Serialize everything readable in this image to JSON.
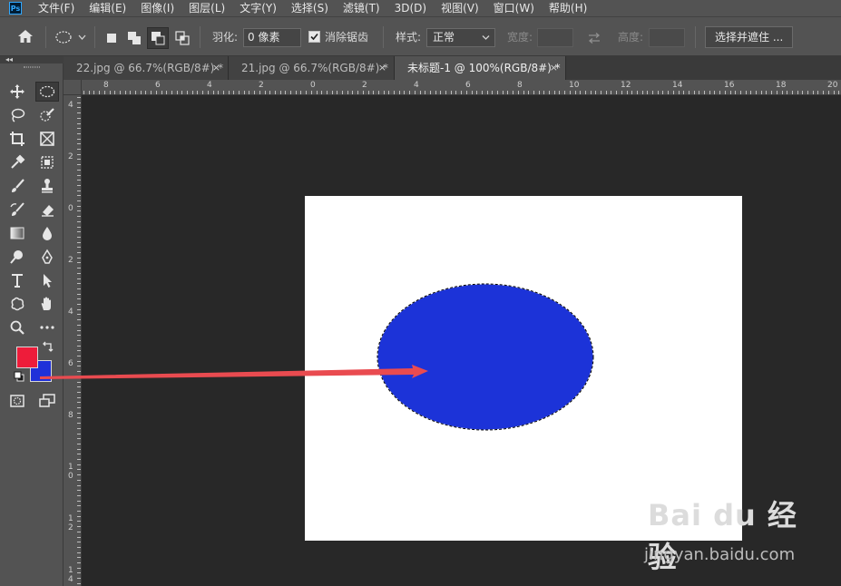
{
  "app": {
    "logo_text": "Ps"
  },
  "menu": [
    "文件(F)",
    "编辑(E)",
    "图像(I)",
    "图层(L)",
    "文字(Y)",
    "选择(S)",
    "滤镜(T)",
    "3D(D)",
    "视图(V)",
    "窗口(W)",
    "帮助(H)"
  ],
  "options": {
    "feather_label": "羽化:",
    "feather_value": "0 像素",
    "antialias_label": "消除锯齿",
    "antialias_checked": true,
    "style_label": "样式:",
    "style_value": "正常",
    "width_label": "宽度:",
    "height_label": "高度:",
    "select_mask_button": "选择并遮住 ..."
  },
  "tabs": [
    {
      "label": "22.jpg @ 66.7%(RGB/8#) *",
      "close": "×",
      "active": false
    },
    {
      "label": "21.jpg @ 66.7%(RGB/8#) *",
      "close": "×",
      "active": false
    },
    {
      "label": "未标题-1 @ 100%(RGB/8#) *",
      "close": "×",
      "active": true
    }
  ],
  "toolbar": {
    "collapse_glyph": "◂◂"
  },
  "colors": {
    "foreground": "#ee1c3a",
    "background": "#1f31d9",
    "ellipse_fill": "#1c33d8",
    "arrow": "#e94b50",
    "document": "#ffffff"
  },
  "ruler": {
    "top_labels": [
      "8",
      "6",
      "4",
      "2",
      "0",
      "2",
      "4",
      "6",
      "8",
      "10",
      "12",
      "14",
      "16",
      "18",
      "20"
    ],
    "left_labels": [
      "4",
      "2",
      "0",
      "2",
      "4",
      "6",
      "8",
      "1 0",
      "1 2",
      "1 4"
    ]
  },
  "watermark": {
    "logo": "Bai du 经验",
    "url": "jingyan.baidu.com"
  }
}
